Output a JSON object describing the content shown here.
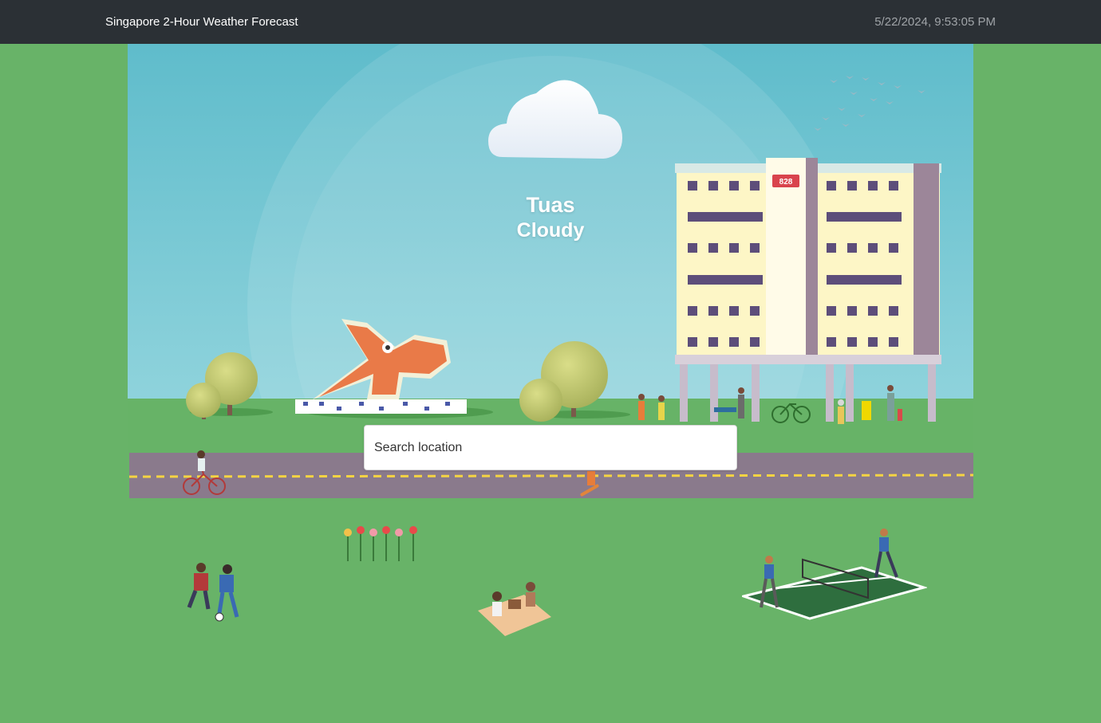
{
  "navbar": {
    "title": "Singapore 2-Hour Weather Forecast",
    "datetime": "5/22/2024, 9:53:05 PM"
  },
  "forecast": {
    "location": "Tuas",
    "condition": "Cloudy",
    "condition_icon": "cloud-icon"
  },
  "building": {
    "block_number": "828"
  },
  "search": {
    "placeholder": "Search location",
    "value": ""
  },
  "colors": {
    "navbar": "#2b3035",
    "page_background": "#68b368",
    "sky": "#7ccad4",
    "road": "#8a7a8c",
    "road_line": "#f5d442"
  }
}
